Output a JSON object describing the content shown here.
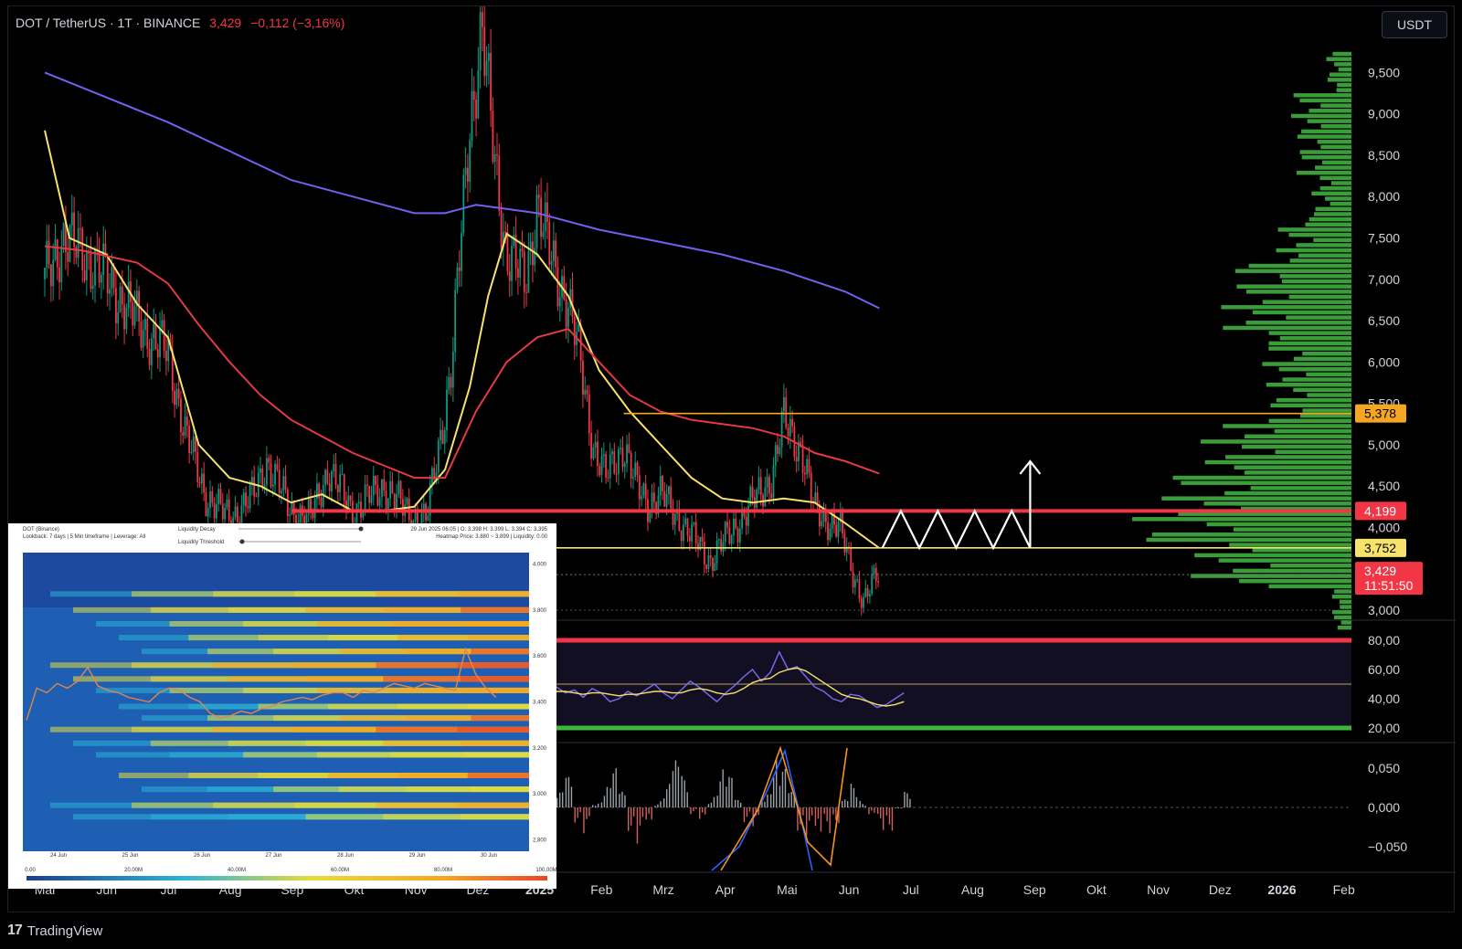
{
  "header": {
    "symbol": "DOT / TetherUS · 1T · BINANCE",
    "price": "3,429",
    "change": "−0,112 (−3,16%)"
  },
  "currency_button": "USDT",
  "brand": {
    "logo": "17",
    "name": "TradingView"
  },
  "colors": {
    "up": "#089981",
    "down": "#f23645",
    "ema_yellow": "#f7e26b",
    "ema_red": "#e53944",
    "ema_purple": "#7b5cf0",
    "profile_green": "#3a9d3a",
    "label_orange": "#f5a623"
  },
  "chart_data": [
    {
      "type": "line",
      "title": "DOT / TetherUS · 1T · BINANCE",
      "y_axis": {
        "min": 2900,
        "max": 10000,
        "ticks": [
          "9,500",
          "9,000",
          "8,500",
          "8,000",
          "7,500",
          "7,000",
          "6,500",
          "6,000",
          "5,500",
          "5,000",
          "4,500",
          "4,000",
          "3,000"
        ]
      },
      "x_axis": {
        "ticks": [
          "Mai",
          "Jun",
          "Jul",
          "Aug",
          "Sep",
          "Okt",
          "Nov",
          "Dez",
          "2025",
          "Feb",
          "Mrz",
          "Apr",
          "Mai",
          "Jun",
          "Jul",
          "Aug",
          "Sep",
          "Okt",
          "Nov",
          "Dez",
          "2026",
          "Feb"
        ]
      },
      "price_series": {
        "name": "DOT",
        "points": [
          [
            0,
            7000
          ],
          [
            0.3,
            7500
          ],
          [
            0.8,
            7200
          ],
          [
            1.2,
            6800
          ],
          [
            1.6,
            6400
          ],
          [
            2.0,
            6100
          ],
          [
            2.3,
            5100
          ],
          [
            2.6,
            4400
          ],
          [
            3.0,
            4100
          ],
          [
            3.4,
            4400
          ],
          [
            3.6,
            4800
          ],
          [
            4.0,
            4200
          ],
          [
            4.3,
            4100
          ],
          [
            4.6,
            4700
          ],
          [
            5.0,
            4200
          ],
          [
            5.5,
            4500
          ],
          [
            6.0,
            4100
          ],
          [
            6.2,
            4100
          ],
          [
            6.6,
            5900
          ],
          [
            6.9,
            8900
          ],
          [
            7.1,
            10000
          ],
          [
            7.3,
            8500
          ],
          [
            7.5,
            7300
          ],
          [
            7.8,
            7000
          ],
          [
            8.0,
            7900
          ],
          [
            8.2,
            7300
          ],
          [
            8.5,
            6700
          ],
          [
            8.7,
            6000
          ],
          [
            8.9,
            5000
          ],
          [
            9.1,
            4600
          ],
          [
            9.4,
            5000
          ],
          [
            9.6,
            4500
          ],
          [
            9.8,
            4300
          ],
          [
            10.0,
            4400
          ],
          [
            10.3,
            4100
          ],
          [
            10.6,
            3800
          ],
          [
            10.8,
            3600
          ],
          [
            11.2,
            4000
          ],
          [
            11.5,
            4300
          ],
          [
            11.8,
            4600
          ],
          [
            12.0,
            5300
          ],
          [
            12.3,
            4900
          ],
          [
            12.5,
            4200
          ],
          [
            12.9,
            4000
          ],
          [
            13.1,
            3500
          ],
          [
            13.3,
            3100
          ],
          [
            13.5,
            3400
          ],
          [
            13.55,
            3429
          ]
        ]
      },
      "ma_series": [
        {
          "name": "",
          "color": "#f7e26b",
          "points": [
            [
              0,
              8800
            ],
            [
              0.4,
              7500
            ],
            [
              1.0,
              7300
            ],
            [
              1.5,
              6700
            ],
            [
              2.0,
              6300
            ],
            [
              2.5,
              5000
            ],
            [
              3.0,
              4600
            ],
            [
              3.5,
              4500
            ],
            [
              4.0,
              4300
            ],
            [
              4.5,
              4400
            ],
            [
              5.0,
              4200
            ],
            [
              5.5,
              4200
            ],
            [
              6.0,
              4250
            ],
            [
              6.5,
              4700
            ],
            [
              6.9,
              5700
            ],
            [
              7.2,
              6800
            ],
            [
              7.5,
              7550
            ],
            [
              8.0,
              7300
            ],
            [
              8.5,
              6800
            ],
            [
              9.0,
              5900
            ],
            [
              9.5,
              5400
            ],
            [
              10.0,
              5000
            ],
            [
              10.5,
              4600
            ],
            [
              11.0,
              4350
            ],
            [
              11.5,
              4300
            ],
            [
              12.0,
              4350
            ],
            [
              12.5,
              4300
            ],
            [
              13.0,
              4050
            ],
            [
              13.55,
              3750
            ]
          ]
        },
        {
          "name": "",
          "color": "#e53944",
          "points": [
            [
              0,
              7400
            ],
            [
              0.6,
              7350
            ],
            [
              1.5,
              7200
            ],
            [
              2.0,
              6950
            ],
            [
              2.5,
              6450
            ],
            [
              3.0,
              6000
            ],
            [
              3.5,
              5600
            ],
            [
              4.0,
              5300
            ],
            [
              4.5,
              5100
            ],
            [
              5.0,
              4900
            ],
            [
              5.5,
              4750
            ],
            [
              6.0,
              4600
            ],
            [
              6.5,
              4600
            ],
            [
              7.0,
              5400
            ],
            [
              7.5,
              6000
            ],
            [
              8.0,
              6300
            ],
            [
              8.5,
              6400
            ],
            [
              9.0,
              6000
            ],
            [
              9.5,
              5600
            ],
            [
              10.0,
              5400
            ],
            [
              10.5,
              5300
            ],
            [
              11.0,
              5250
            ],
            [
              11.5,
              5200
            ],
            [
              12.0,
              5100
            ],
            [
              12.5,
              4900
            ],
            [
              13.0,
              4800
            ],
            [
              13.55,
              4650
            ]
          ]
        },
        {
          "name": "",
          "color": "#7b5cf0",
          "points": [
            [
              0,
              9500
            ],
            [
              1.0,
              9200
            ],
            [
              2.0,
              8900
            ],
            [
              3.0,
              8550
            ],
            [
              4.0,
              8200
            ],
            [
              5.0,
              8000
            ],
            [
              6.0,
              7800
            ],
            [
              6.5,
              7800
            ],
            [
              7.0,
              7900
            ],
            [
              7.5,
              7850
            ],
            [
              8.0,
              7800
            ],
            [
              9.0,
              7600
            ],
            [
              10.0,
              7450
            ],
            [
              11.0,
              7300
            ],
            [
              12.0,
              7100
            ],
            [
              13.0,
              6850
            ],
            [
              13.55,
              6650
            ]
          ]
        }
      ],
      "levels": [
        {
          "value": 5378,
          "label": "5,378",
          "color": "#f5a623"
        },
        {
          "value": 4199,
          "label": "4,199",
          "color": "#f23645"
        },
        {
          "value": 3752,
          "label": "3,752",
          "color": "#f7e26b"
        }
      ],
      "last_price": {
        "value": 3429,
        "label": "3,429",
        "countdown": "11:51:50",
        "color": "#f23645"
      },
      "volume_profile": {
        "prices": [
          9500,
          9000,
          8500,
          8000,
          7500,
          7000,
          6500,
          6000,
          5500,
          5000,
          4500,
          4000,
          3500,
          3000
        ],
        "volumes": [
          25,
          60,
          55,
          40,
          75,
          120,
          130,
          90,
          85,
          150,
          190,
          220,
          160,
          20
        ]
      },
      "projection": {
        "zigzag": [
          [
            13.6,
            3750
          ],
          [
            13.9,
            4199
          ],
          [
            14.2,
            3752
          ],
          [
            14.5,
            4199
          ],
          [
            14.8,
            3752
          ],
          [
            15.1,
            4199
          ],
          [
            15.4,
            3752
          ],
          [
            15.7,
            4199
          ],
          [
            16.0,
            3752
          ]
        ],
        "arrow_to": 4800
      }
    },
    {
      "type": "line",
      "y_axis": {
        "ticks": [
          "80,00",
          "60,00",
          "40,00",
          "20,00"
        ]
      },
      "levels": [
        80,
        50,
        20
      ],
      "series": [
        {
          "name": "",
          "values": [
            48,
            44,
            46,
            41,
            47,
            44,
            38,
            40,
            45,
            42,
            46,
            50,
            44,
            40,
            46,
            52,
            48,
            43,
            38,
            44,
            49,
            55,
            60,
            52,
            58,
            72,
            60,
            62,
            55,
            48,
            45,
            40,
            38,
            43,
            42,
            38,
            34,
            36,
            40,
            44
          ]
        },
        {
          "name": "",
          "values": [
            45,
            45,
            44,
            43,
            44,
            44,
            43,
            42,
            43,
            43,
            44,
            45,
            45,
            44,
            44,
            46,
            47,
            46,
            44,
            43,
            44,
            47,
            51,
            53,
            54,
            58,
            60,
            61,
            59,
            55,
            51,
            47,
            43,
            41,
            40,
            38,
            36,
            35,
            36,
            38
          ]
        }
      ]
    },
    {
      "type": "bar",
      "y_axis": {
        "ticks": [
          "0,050",
          "0,000",
          "−0,050"
        ]
      },
      "values": [
        0.02,
        0.04,
        -0.02,
        -0.05,
        0.01,
        0.03,
        0.05,
        0.02,
        -0.03,
        -0.06,
        -0.04,
        0.01,
        0.03,
        0.06,
        0.04,
        -0.01,
        -0.03,
        0.02,
        0.05,
        0.04,
        0.01,
        -0.02,
        -0.04,
        0.03,
        0.07,
        0.05,
        0.02,
        -0.03,
        -0.05,
        -0.07,
        -0.04,
        -0.02,
        0.01,
        0.03,
        0.01,
        -0.02,
        -0.04,
        -0.03,
        0.0,
        0.02
      ]
    },
    {
      "type": "heatmap",
      "header_left": [
        "DOT (Binance)",
        "Lookback: 7 days | 5 Min timeframe | Leverage: All"
      ],
      "controls": [
        "Liquidity Decay",
        "Liquidity Threshold"
      ],
      "header_right": [
        "29 Jun 2025 06:05 | O: 3.398 H: 3.399 L: 3.394 C: 3.395",
        "Heatmap Price: 3.880 ~ 3.899 | Liquidity: 0.00"
      ],
      "y_ticks": [
        "4.000",
        "3.800",
        "3.600",
        "3.400",
        "3.200",
        "3.000",
        "2.800"
      ],
      "x_ticks": [
        "24 Jun",
        "25 Jun",
        "26 Jun",
        "27 Jun",
        "28 Jun",
        "29 Jun",
        "30 Jun"
      ],
      "scale_ticks": [
        "0.00",
        "20.00M",
        "40.00M",
        "60.00M",
        "80.00M",
        "100.00M"
      ],
      "bands": [
        {
          "price": 3.87,
          "intensity": 0.7
        },
        {
          "price": 3.8,
          "intensity": 0.9
        },
        {
          "price": 3.74,
          "intensity": 0.8
        },
        {
          "price": 3.68,
          "intensity": 0.75
        },
        {
          "price": 3.62,
          "intensity": 0.85
        },
        {
          "price": 3.56,
          "intensity": 0.95
        },
        {
          "price": 3.5,
          "intensity": 1.0
        },
        {
          "price": 3.45,
          "intensity": 0.8
        },
        {
          "price": 3.38,
          "intensity": 0.6
        },
        {
          "price": 3.33,
          "intensity": 0.85
        },
        {
          "price": 3.28,
          "intensity": 0.95
        },
        {
          "price": 3.22,
          "intensity": 0.7
        },
        {
          "price": 3.17,
          "intensity": 0.6
        },
        {
          "price": 3.08,
          "intensity": 0.9
        },
        {
          "price": 3.02,
          "intensity": 0.55
        },
        {
          "price": 2.95,
          "intensity": 0.7
        },
        {
          "price": 2.9,
          "intensity": 0.5
        }
      ],
      "price_path": [
        3.32,
        3.46,
        3.44,
        3.48,
        3.46,
        3.49,
        3.55,
        3.47,
        3.45,
        3.44,
        3.42,
        3.41,
        3.4,
        3.44,
        3.46,
        3.45,
        3.42,
        3.4,
        3.35,
        3.33,
        3.34,
        3.36,
        3.35,
        3.37,
        3.38,
        3.4,
        3.41,
        3.42,
        3.41,
        3.43,
        3.44,
        3.44,
        3.42,
        3.45,
        3.44,
        3.46,
        3.48,
        3.47,
        3.46,
        3.48,
        3.47,
        3.46,
        3.45,
        3.63,
        3.52,
        3.46,
        3.42
      ]
    }
  ]
}
